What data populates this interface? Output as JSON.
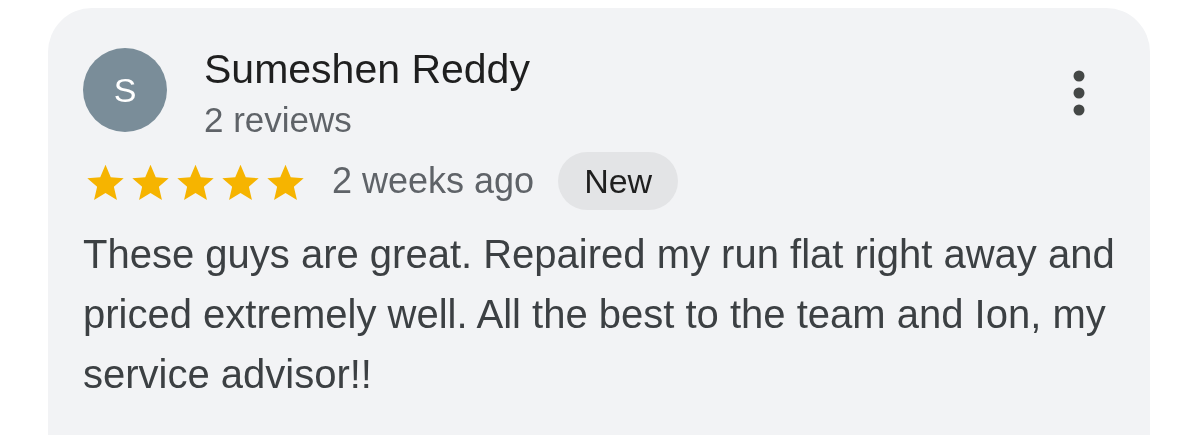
{
  "review": {
    "avatar_letter": "S",
    "author": "Sumeshen Reddy",
    "review_count": "2 reviews",
    "stars": 5,
    "time": "2 weeks ago",
    "badge": "New",
    "text": "These guys are great. Repaired my run flat right away and priced extremely well. All the best to the team and Ion, my service advisor!!"
  }
}
